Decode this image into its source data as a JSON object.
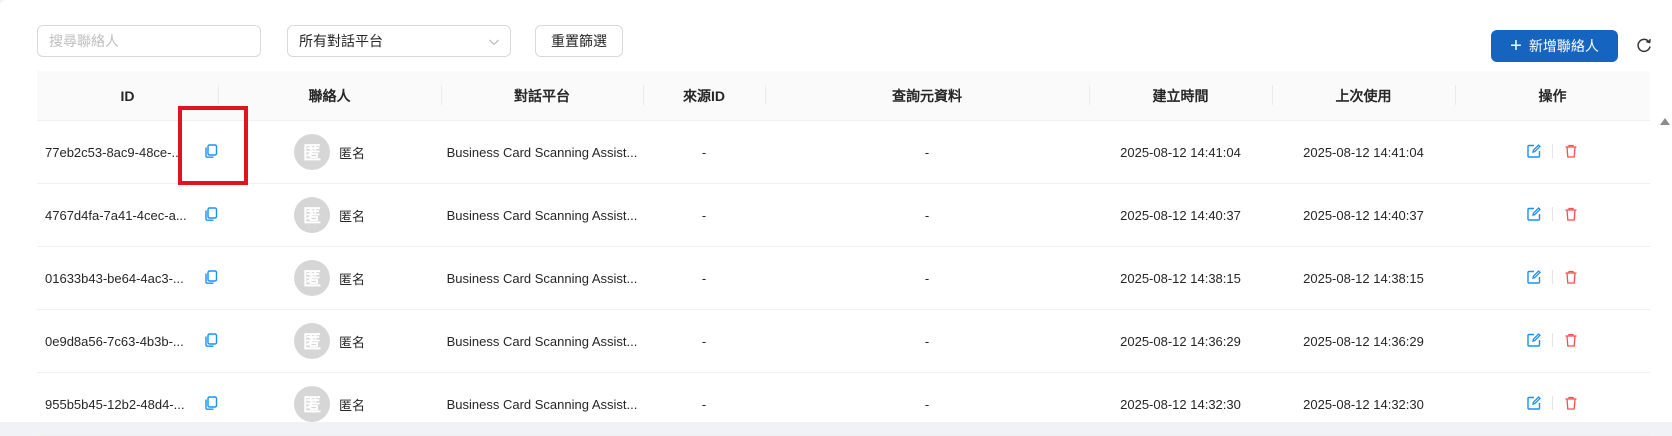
{
  "filters": {
    "search_placeholder": "搜尋聯絡人",
    "platform_selected": "所有對話平台",
    "reset_label": "重置篩選"
  },
  "header_actions": {
    "add_label": "新增聯絡人"
  },
  "table": {
    "columns": [
      "ID",
      "聯絡人",
      "對話平台",
      "來源ID",
      "查詢元資料",
      "建立時間",
      "上次使用",
      "操作"
    ],
    "rows": [
      {
        "id": "77eb2c53-8ac9-48ce-...",
        "avatar": "匿",
        "contact": "匿名",
        "platform": "Business Card Scanning Assist...",
        "source_id": "-",
        "metadata": "-",
        "created": "2025-08-12 14:41:04",
        "last_used": "2025-08-12 14:41:04"
      },
      {
        "id": "4767d4fa-7a41-4cec-a...",
        "avatar": "匿",
        "contact": "匿名",
        "platform": "Business Card Scanning Assist...",
        "source_id": "-",
        "metadata": "-",
        "created": "2025-08-12 14:40:37",
        "last_used": "2025-08-12 14:40:37"
      },
      {
        "id": "01633b43-be64-4ac3-...",
        "avatar": "匿",
        "contact": "匿名",
        "platform": "Business Card Scanning Assist...",
        "source_id": "-",
        "metadata": "-",
        "created": "2025-08-12 14:38:15",
        "last_used": "2025-08-12 14:38:15"
      },
      {
        "id": "0e9d8a56-7c63-4b3b-...",
        "avatar": "匿",
        "contact": "匿名",
        "platform": "Business Card Scanning Assist...",
        "source_id": "-",
        "metadata": "-",
        "created": "2025-08-12 14:36:29",
        "last_used": "2025-08-12 14:36:29"
      },
      {
        "id": "955b5b45-12b2-48d4-...",
        "avatar": "匿",
        "contact": "匿名",
        "platform": "Business Card Scanning Assist...",
        "source_id": "-",
        "metadata": "-",
        "created": "2025-08-12 14:32:30",
        "last_used": "2025-08-12 14:32:30"
      }
    ]
  },
  "icons": {
    "copy": "copy-icon",
    "edit": "edit-icon",
    "delete": "trash-icon",
    "refresh": "refresh-icon",
    "dropdown": "chevron-down-icon",
    "add": "plus-icon"
  },
  "colors": {
    "primary": "#1565c0",
    "edit": "#1890ff",
    "delete": "#ff4d4f",
    "highlight": "#e0141e",
    "avatar_bg": "#d6d6d6"
  }
}
